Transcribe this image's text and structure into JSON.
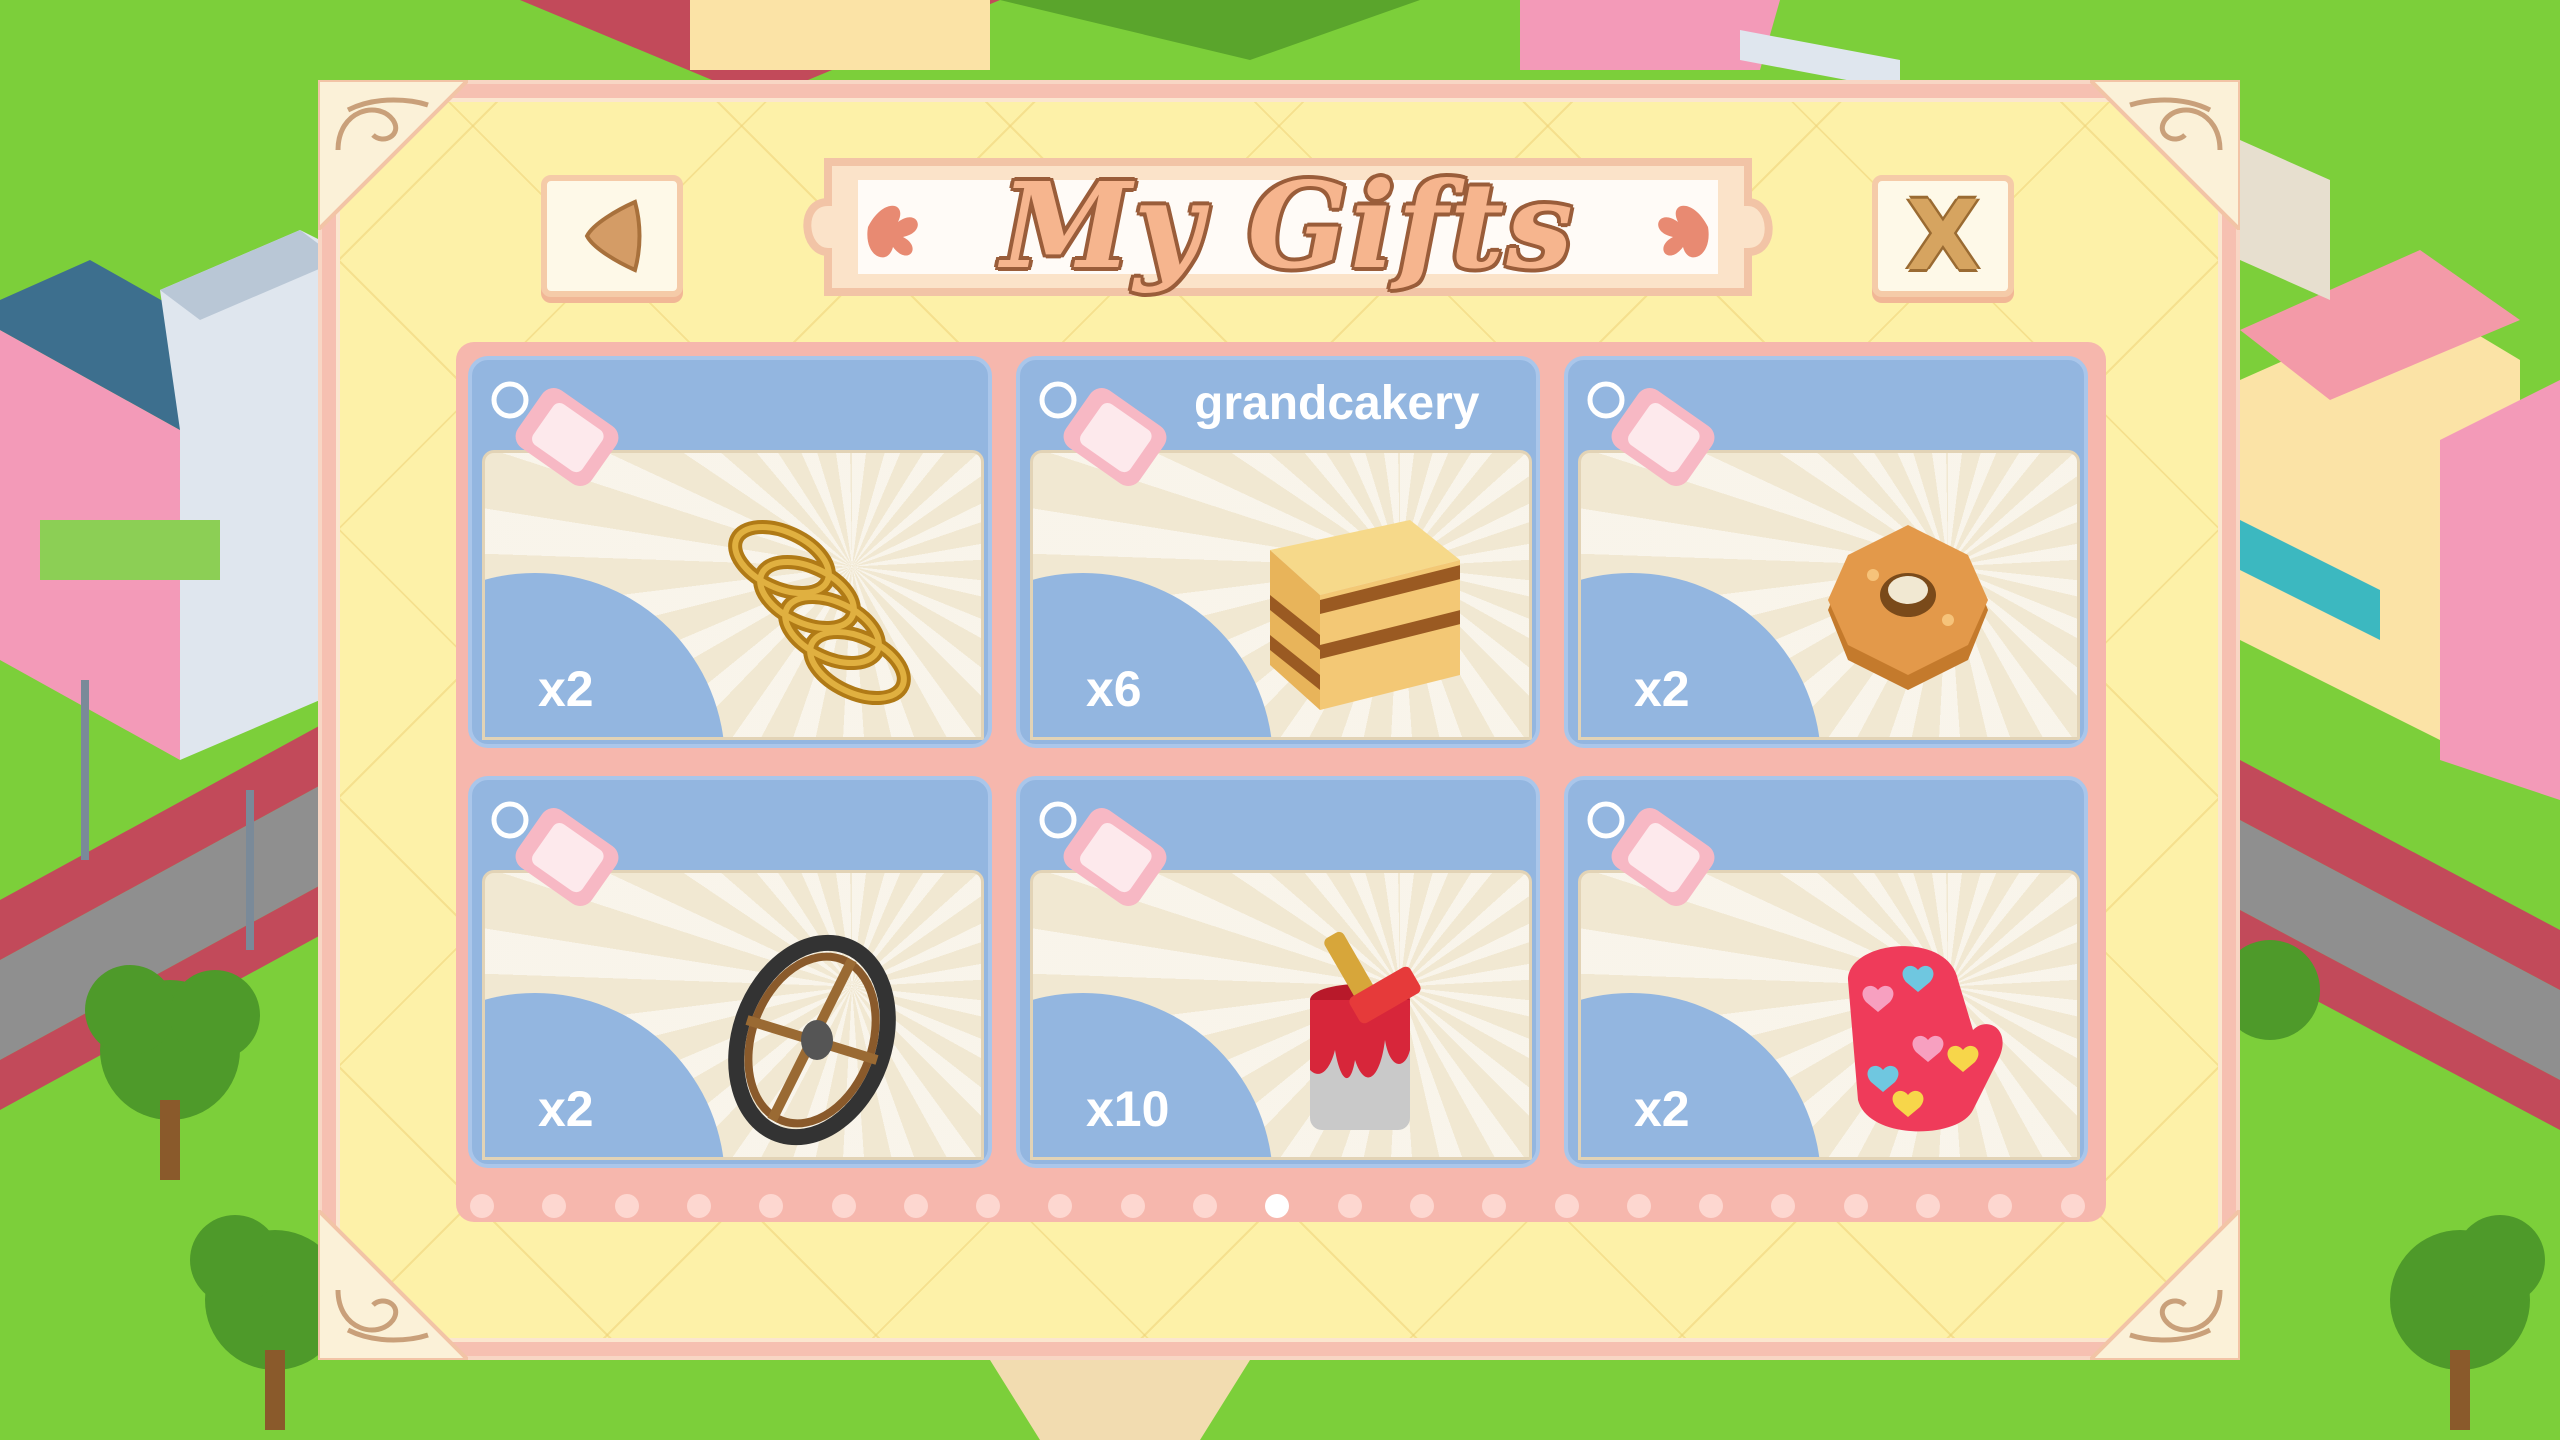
{
  "header": {
    "title": "My Gifts",
    "back_icon": "back-arrow-icon",
    "close_label": "X"
  },
  "gifts": [
    {
      "item": "spring-coil-icon",
      "quantity": "x2",
      "sender": ""
    },
    {
      "item": "cake-slice-icon",
      "quantity": "x6",
      "sender": "grandcakery"
    },
    {
      "item": "donut-icon",
      "quantity": "x2",
      "sender": ""
    },
    {
      "item": "wagon-wheel-icon",
      "quantity": "x2",
      "sender": ""
    },
    {
      "item": "paint-bucket-icon",
      "quantity": "x10",
      "sender": ""
    },
    {
      "item": "heart-mitten-icon",
      "quantity": "x2",
      "sender": ""
    }
  ],
  "pagination": {
    "pages": 23,
    "current": 12
  },
  "colors": {
    "frame": "#f6c0b1",
    "panel_bg": "#fdf1a8",
    "card_blue": "#93b6e0",
    "title_fill": "#f6b58e",
    "title_outline": "#9a5d3a",
    "active_dot": "#ffffff"
  }
}
